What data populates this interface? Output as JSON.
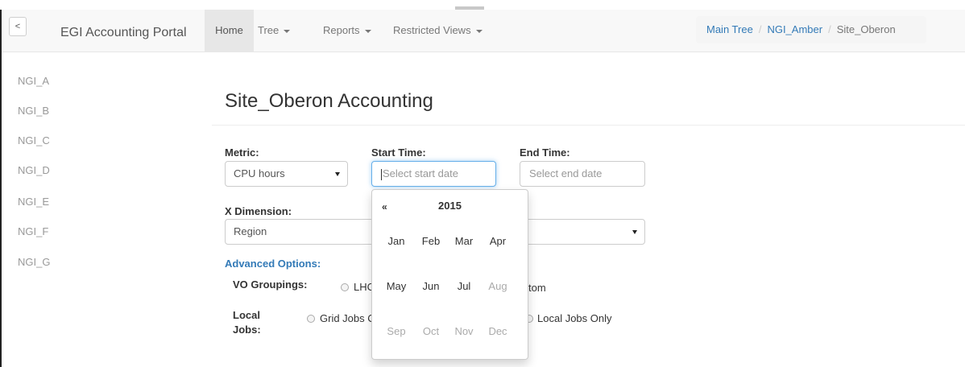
{
  "header": {
    "collapse_label": "<",
    "brand": "EGI Accounting Portal",
    "nav": [
      {
        "label": "Home"
      },
      {
        "label": "Tree"
      },
      {
        "label": "Reports"
      },
      {
        "label": "Restricted Views"
      }
    ],
    "breadcrumb": [
      "Main Tree",
      "NGI_Amber",
      "Site_Oberon"
    ]
  },
  "sidebar": {
    "items": [
      "NGI_A",
      "NGI_B",
      "NGI_C",
      "NGI_D",
      "NGI_E",
      "NGI_F",
      "NGI_G"
    ]
  },
  "main": {
    "title": "Site_Oberon Accounting",
    "metric_label": "Metric:",
    "metric_value": "CPU hours",
    "start_label": "Start Time:",
    "start_placeholder": "Select start date",
    "end_label": "End Time:",
    "end_placeholder": "Select end date",
    "xdim_label": "X Dimension:",
    "xdim_value": "Region",
    "advanced_label": "Advanced Options:",
    "vo_label": "VO Groupings:",
    "vo_option_partial": "LHC",
    "vo_option_right": "tom",
    "local_label_1": "Local",
    "local_label_2": "Jobs:",
    "local_option_1": "Grid Jobs C",
    "local_option_2": "Local Jobs Only"
  },
  "datepicker": {
    "prev": "«",
    "year": "2015",
    "months": [
      {
        "label": "Jan",
        "enabled": true
      },
      {
        "label": "Feb",
        "enabled": true
      },
      {
        "label": "Mar",
        "enabled": true
      },
      {
        "label": "Apr",
        "enabled": true
      },
      {
        "label": "May",
        "enabled": true
      },
      {
        "label": "Jun",
        "enabled": true
      },
      {
        "label": "Jul",
        "enabled": true
      },
      {
        "label": "Aug",
        "enabled": false
      },
      {
        "label": "Sep",
        "enabled": false
      },
      {
        "label": "Oct",
        "enabled": false
      },
      {
        "label": "Nov",
        "enabled": false
      },
      {
        "label": "Dec",
        "enabled": false
      }
    ]
  },
  "colors": {
    "link": "#337ab7",
    "focus": "#66afe9",
    "navbar_bg": "#f8f8f8"
  }
}
